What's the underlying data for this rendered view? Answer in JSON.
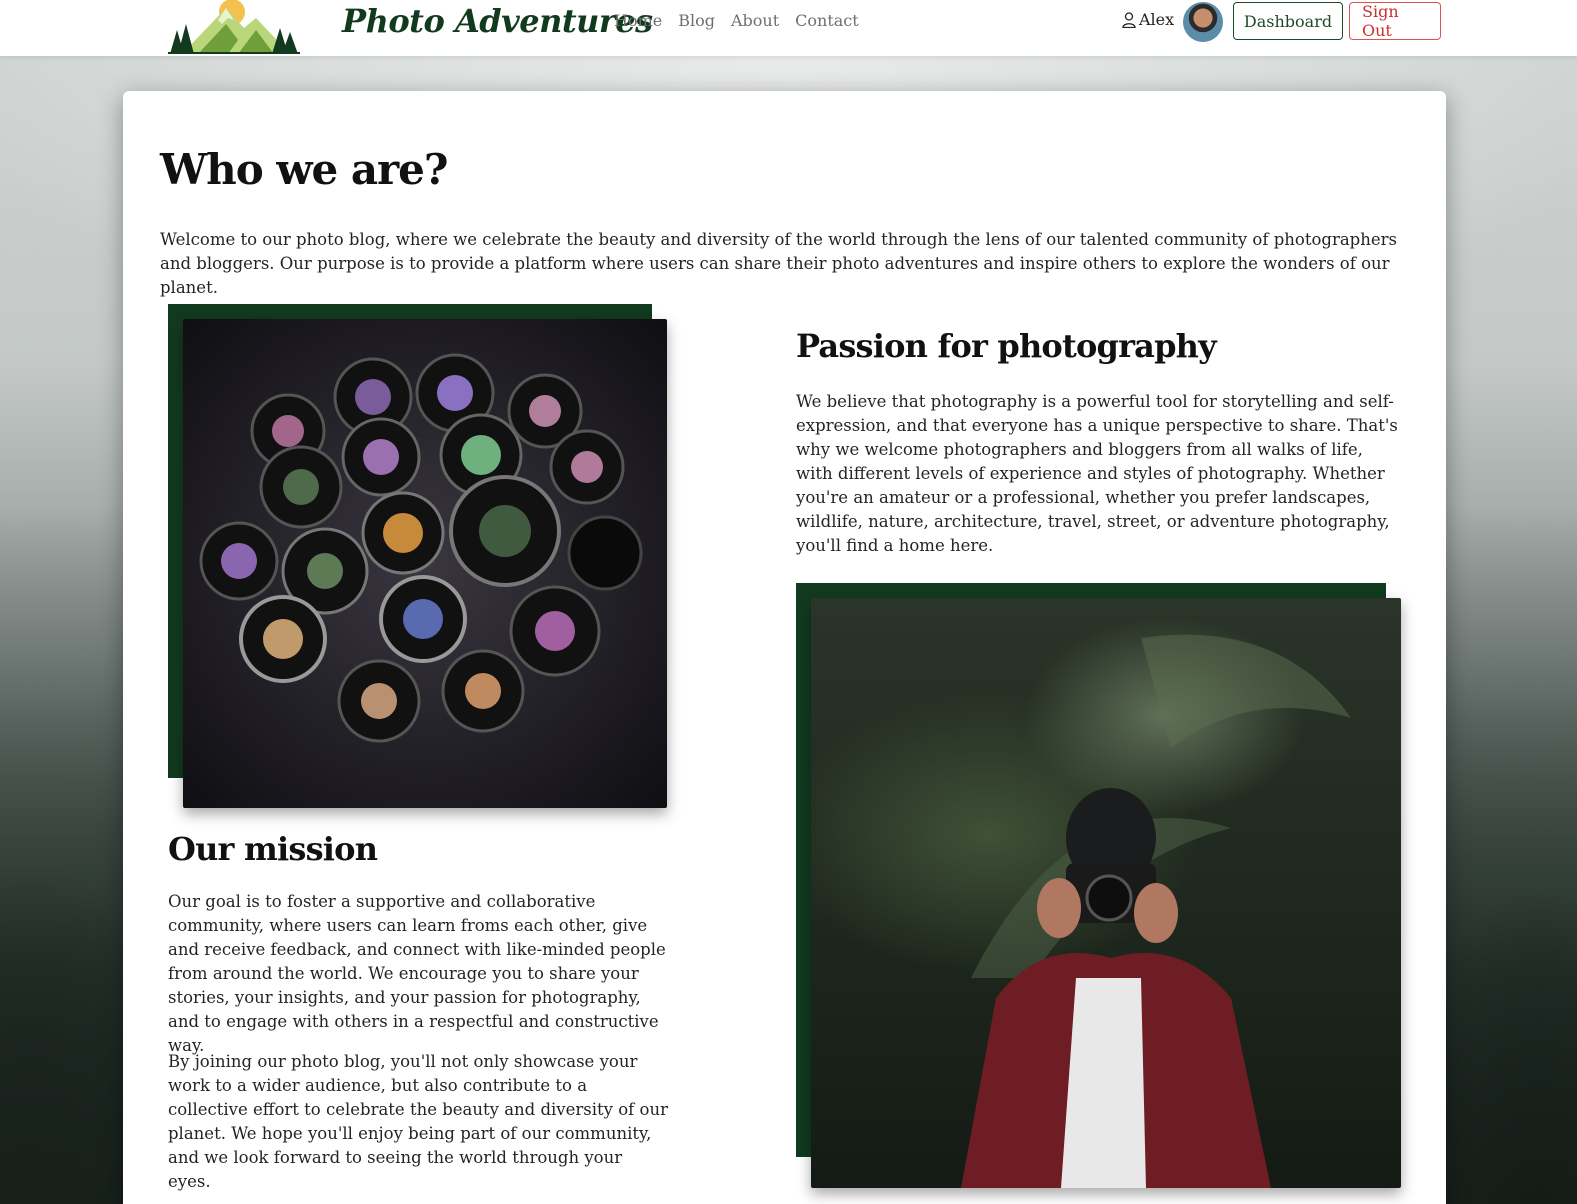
{
  "header": {
    "brand": "Photo Adventures",
    "nav": [
      "Home",
      "Blog",
      "About",
      "Contact"
    ],
    "user_name": "Alex",
    "dashboard_label": "Dashboard",
    "signout_label": "Sign Out"
  },
  "main": {
    "title": "Who we are?",
    "intro": "Welcome to our photo blog, where we celebrate the beauty and diversity of the world through the lens of our talented community of photographers and bloggers. Our purpose is to provide a platform where users can share their photo adventures and inspire others to explore the wonders of our planet.",
    "passion": {
      "heading": "Passion for photography",
      "text": "We believe that photography is a powerful tool for storytelling and self-expression, and that everyone has a unique perspective to share. That's why we welcome photographers and bloggers from all walks of life, with different levels of experience and styles of photography. Whether you're an amateur or a professional, whether you prefer landscapes, wildlife, nature, architecture, travel, street, or adventure photography, you'll find a home here."
    },
    "mission": {
      "heading": "Our mission",
      "paragraphs": [
        "Our goal is to foster a supportive and collaborative community, where users can learn froms each other, give and receive feedback, and connect with like-minded people from around the world. We encourage you to share your stories, your insights, and your passion for photography, and to engage with others in a respectful and constructive way.",
        "By joining our photo blog, you'll not only showcase your work to a wider audience, but also contribute to a collective effort to celebrate the beauty and diversity of our planet. We hope you'll enjoy being part of our community, and we look forward to seeing the world through your eyes."
      ]
    }
  },
  "colors": {
    "brand_green": "#123a1f",
    "signout_red": "#c9302c"
  },
  "icons": {
    "user": "user-icon",
    "logo": "mountain-logo-icon"
  }
}
